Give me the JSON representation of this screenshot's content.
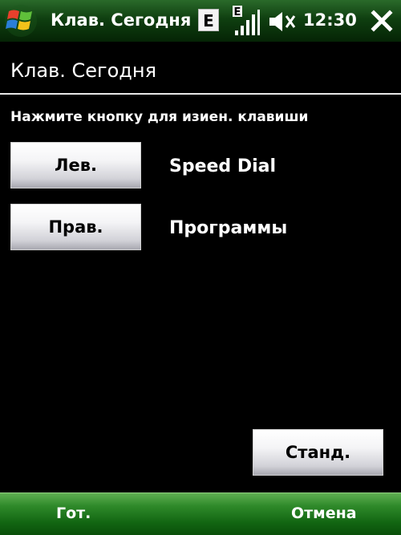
{
  "statusbar": {
    "title": "Клав. Сегодня",
    "network_badge": "E",
    "signal_badge": "E",
    "time": "12:30"
  },
  "window": {
    "title": "Клав. Сегодня"
  },
  "content": {
    "instruction": "Нажмите кнопку для изиен. клавиши",
    "left_key_button": "Лев.",
    "left_key_assignment": "Speed Dial",
    "right_key_button": "Прав.",
    "right_key_assignment": "Программы",
    "default_button": "Станд."
  },
  "softkeys": {
    "left": "Гот.",
    "right": "Отмена"
  },
  "colors": {
    "statusbar_green": "#0f3f10",
    "softbar_green": "#2f8a2a",
    "background": "#000000",
    "text": "#ffffff"
  },
  "icons": {
    "start": "windows-flag-icon",
    "signal": "signal-strength-icon",
    "volume": "volume-muted-icon",
    "close": "close-icon"
  }
}
